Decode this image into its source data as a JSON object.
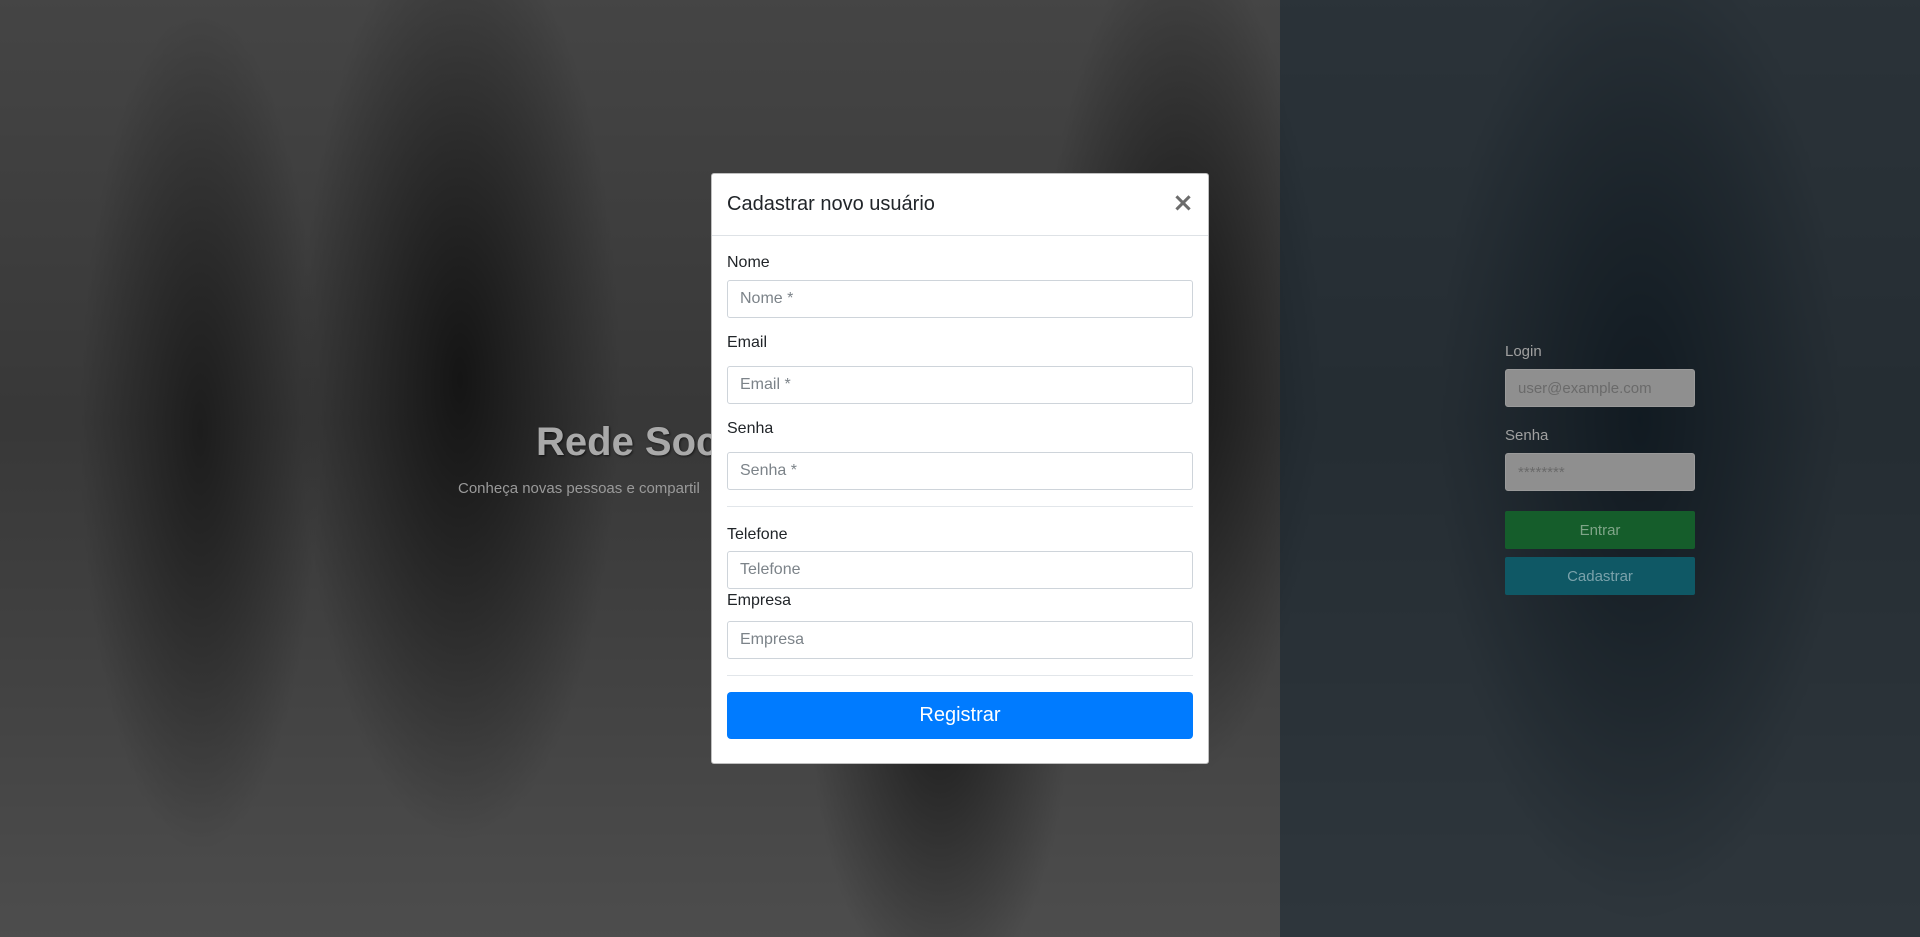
{
  "hero": {
    "title": "Rede Soci",
    "subtitle": "Conheça novas pessoas e compartil"
  },
  "login_panel": {
    "login_label": "Login",
    "login_placeholder": "user@example.com",
    "password_label": "Senha",
    "password_placeholder": "********",
    "enter_button": "Entrar",
    "register_button": "Cadastrar"
  },
  "modal": {
    "title": "Cadastrar novo usuário",
    "close_icon": "close-icon",
    "close_symbol": "×",
    "fields": {
      "nome": {
        "label": "Nome",
        "placeholder": "Nome *"
      },
      "email": {
        "label": "Email",
        "placeholder": "Email *"
      },
      "senha": {
        "label": "Senha",
        "placeholder": "Senha *"
      },
      "telefone": {
        "label": "Telefone",
        "placeholder": "Telefone"
      },
      "empresa": {
        "label": "Empresa",
        "placeholder": "Empresa"
      }
    },
    "submit_label": "Registrar"
  },
  "colors": {
    "primary": "#007bff",
    "success_dimmed": "#155d2b",
    "info_dimmed": "#0f5865"
  }
}
